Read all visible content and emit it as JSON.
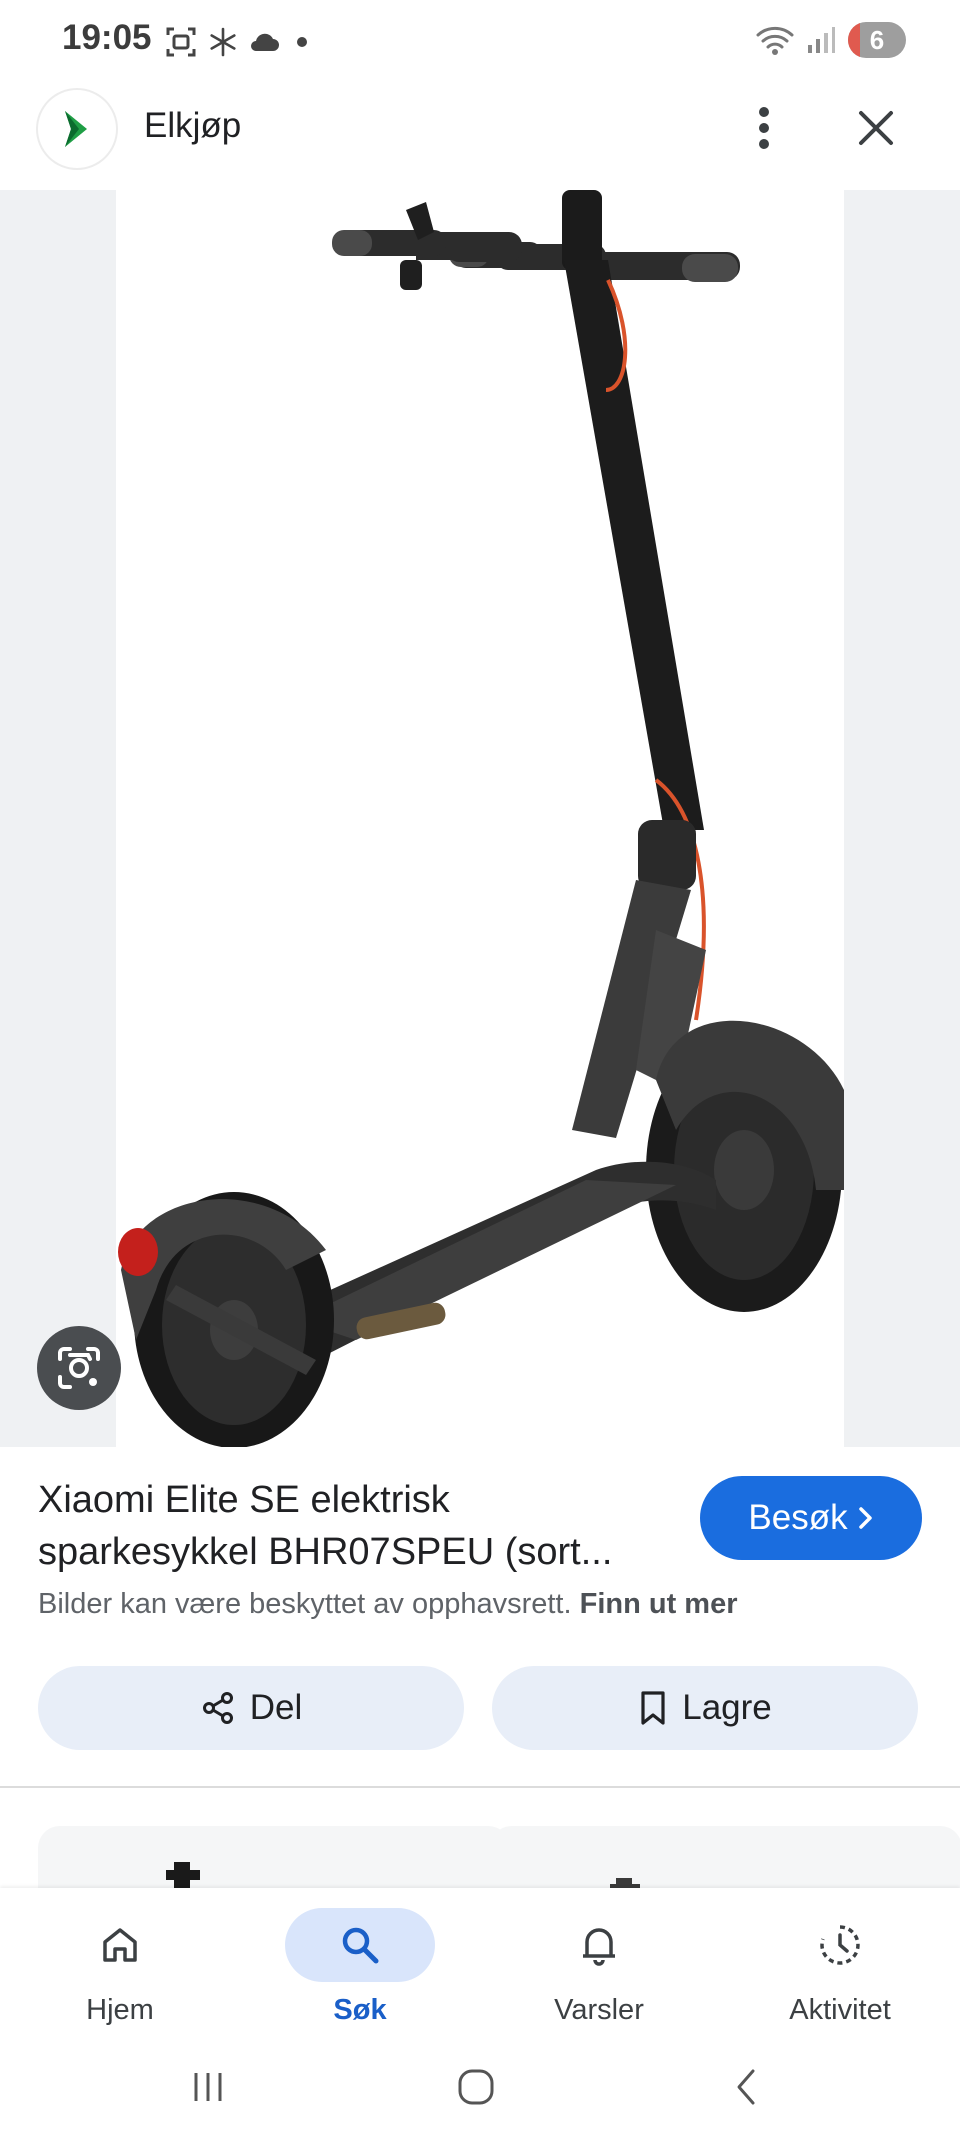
{
  "status_bar": {
    "time": "19:05",
    "battery": "6",
    "left_icons": [
      "screen-record-icon",
      "snowflake-icon",
      "cloud-icon",
      "dot-icon"
    ],
    "right_icons": [
      "wifi-icon",
      "signal-icon",
      "battery-icon"
    ]
  },
  "header": {
    "site_name": "Elkjøp",
    "logo": "elkjop-logo",
    "actions": [
      "more-vert-icon",
      "close-icon"
    ]
  },
  "result": {
    "title": "Xiaomi Elite SE elektrisk sparkesykkel BHR07SPEU (sort...",
    "visit_label": "Besøk",
    "copyright_text": "Bilder kan være beskyttet av opphavsrett.",
    "copyright_link": "Finn ut mer",
    "share_label": "Del",
    "save_label": "Lagre"
  },
  "bottom_nav": {
    "items": [
      {
        "label": "Hjem",
        "icon": "home-icon"
      },
      {
        "label": "Søk",
        "icon": "search-icon",
        "active": true
      },
      {
        "label": "Varsler",
        "icon": "bell-icon"
      },
      {
        "label": "Aktivitet",
        "icon": "activity-icon"
      }
    ]
  },
  "colors": {
    "accent": "#1a6ddf",
    "pill_bg": "#e8eef8",
    "active_nav_bg": "#d9e5fb",
    "active_nav_text": "#1a5fc8"
  }
}
